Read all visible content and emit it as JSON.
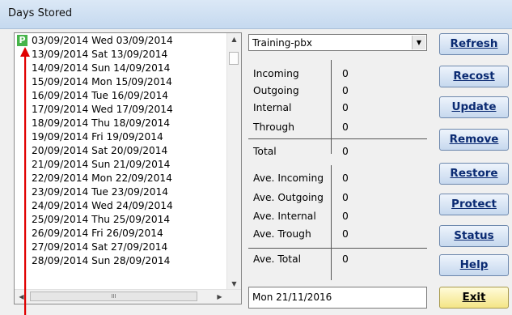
{
  "window": {
    "title": "Days Stored"
  },
  "day_list": {
    "items": [
      {
        "label": "03/09/2014 Wed 03/09/2014",
        "flag": "P"
      },
      {
        "label": "13/09/2014 Sat 13/09/2014"
      },
      {
        "label": "14/09/2014 Sun 14/09/2014"
      },
      {
        "label": "15/09/2014 Mon 15/09/2014"
      },
      {
        "label": "16/09/2014 Tue 16/09/2014"
      },
      {
        "label": "17/09/2014 Wed 17/09/2014"
      },
      {
        "label": "18/09/2014 Thu 18/09/2014"
      },
      {
        "label": "19/09/2014 Fri 19/09/2014"
      },
      {
        "label": "20/09/2014 Sat 20/09/2014"
      },
      {
        "label": "21/09/2014 Sun 21/09/2014"
      },
      {
        "label": "22/09/2014 Mon 22/09/2014"
      },
      {
        "label": "23/09/2014 Tue 23/09/2014"
      },
      {
        "label": "24/09/2014 Wed 24/09/2014"
      },
      {
        "label": "25/09/2014 Thu 25/09/2014"
      },
      {
        "label": "26/09/2014 Fri 26/09/2014"
      },
      {
        "label": "27/09/2014 Sat 27/09/2014"
      },
      {
        "label": "28/09/2014 Sun 28/09/2014"
      }
    ],
    "hscroll_grip": "III"
  },
  "site_select": {
    "value": "Training-pbx"
  },
  "stats": {
    "incoming": {
      "label": "Incoming",
      "value": "0"
    },
    "outgoing": {
      "label": "Outgoing",
      "value": "0"
    },
    "internal": {
      "label": "Internal",
      "value": "0"
    },
    "through": {
      "label": "Through",
      "value": "0"
    },
    "total": {
      "label": "Total",
      "value": "0"
    },
    "ave_incoming": {
      "label": "Ave. Incoming",
      "value": "0"
    },
    "ave_outgoing": {
      "label": "Ave. Outgoing",
      "value": "0"
    },
    "ave_internal": {
      "label": "Ave. Internal",
      "value": "0"
    },
    "ave_trough": {
      "label": "Ave. Trough",
      "value": "0"
    },
    "ave_total": {
      "label": "Ave. Total",
      "value": "0"
    }
  },
  "current_date": "Mon 21/11/2016",
  "buttons": {
    "refresh": "Refresh",
    "recost": "Recost",
    "update": "Update",
    "remove": "Remove",
    "restore": "Restore",
    "protect": "Protect",
    "status": "Status",
    "help": "Help",
    "exit": "Exit"
  },
  "colors": {
    "flag": "#46b44a",
    "pointer_arrow": "#e00000",
    "button_text": "#0a2a72",
    "exit_button": "#f4e586"
  }
}
